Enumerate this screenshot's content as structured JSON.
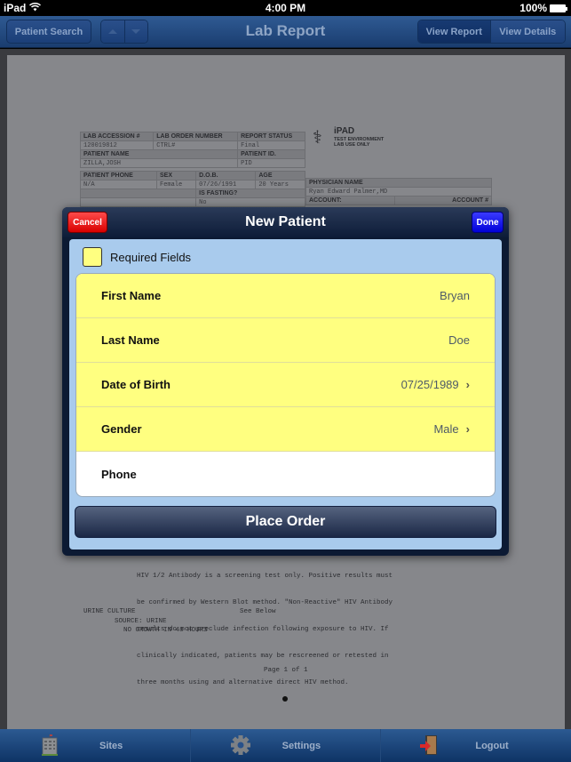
{
  "status_bar": {
    "device": "iPad",
    "time": "4:00 PM",
    "battery": "100%"
  },
  "navbar": {
    "title": "Lab Report",
    "patient_search_label": "Patient Search",
    "prev_icon": "up-arrow-icon",
    "next_icon": "down-arrow-icon",
    "segments": [
      {
        "label": "View Report",
        "selected": true
      },
      {
        "label": "View Details",
        "selected": false
      }
    ]
  },
  "report": {
    "table": {
      "lab_accession_label": "LAB ACCESSION #",
      "lab_accession": "120019812",
      "lab_order_label": "LAB ORDER NUMBER",
      "lab_order": "CTRL#",
      "report_status_label": "REPORT STATUS",
      "report_status": "Final",
      "patient_name_label": "PATIENT NAME",
      "patient_name": "ZILLA,JOSH",
      "patient_id_label": "PATIENT ID.",
      "patient_id": "PID",
      "patient_phone_label": "PATIENT PHONE",
      "patient_phone": "N/A",
      "sex_label": "SEX",
      "sex": "Female",
      "dob_label": "D.O.B.",
      "dob": "07/26/1991",
      "age_label": "AGE",
      "age": "20 Years",
      "fasting_label": "IS FASTING?",
      "fasting": "No"
    },
    "physician": {
      "physician_name_label": "PHYSICIAN NAME",
      "physician_name": "Ryan Edward Palmer,MD",
      "account_label": "ACCOUNT:",
      "account_num_label": "ACCOUNT #"
    },
    "logo": {
      "name": "iPAD",
      "line1": "TEST ENVIRONMENT",
      "line2": "LAB USE ONLY"
    },
    "hiv_note": [
      "HIV 1/2 Antibody is a screening test only. Positive results must",
      "be confirmed by Western Blot method. \"Non-Reactive\" HIV Antibody",
      "results do not preclude infection following exposure to HIV. If",
      "clinically indicated, patients may be rescreened or retested in",
      "three months using and alternative direct HIV method."
    ],
    "urine_culture": "URINE CULTURE",
    "urine_result": "See Below",
    "urine_source": "SOURCE: URINE",
    "urine_growth": "NO GROWTH IN 48 HOURS",
    "page_indicator": "Page 1 of 1"
  },
  "modal": {
    "title": "New Patient",
    "cancel_label": "Cancel",
    "done_label": "Done",
    "legend_label": "Required Fields",
    "required_color": "#ffff80",
    "fields": [
      {
        "label": "First Name",
        "value": "Bryan",
        "required": true,
        "disclosure": false
      },
      {
        "label": "Last Name",
        "value": "Doe",
        "required": true,
        "disclosure": false
      },
      {
        "label": "Date of Birth",
        "value": "07/25/1989",
        "required": true,
        "disclosure": true
      },
      {
        "label": "Gender",
        "value": "Male",
        "required": true,
        "disclosure": true
      },
      {
        "label": "Phone",
        "value": "",
        "required": false,
        "disclosure": false
      }
    ],
    "place_order_label": "Place Order"
  },
  "tabbar": {
    "items": [
      {
        "label": "Sites",
        "icon": "building-icon"
      },
      {
        "label": "Settings",
        "icon": "gear-icon"
      },
      {
        "label": "Logout",
        "icon": "logout-door-icon"
      }
    ]
  }
}
